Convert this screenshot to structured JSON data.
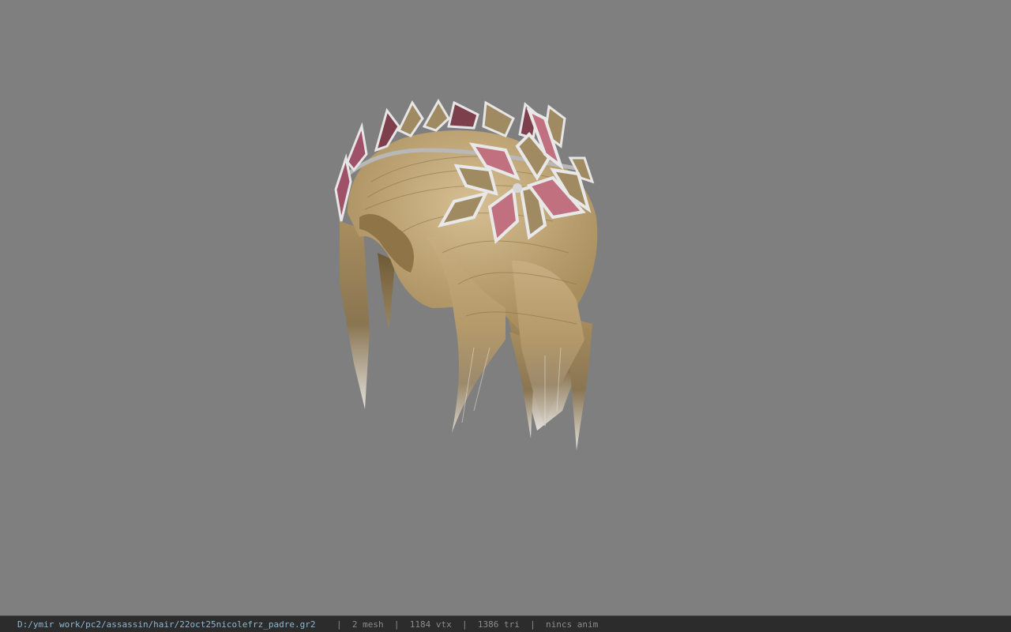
{
  "viewport": {
    "background": "#7f7f7f",
    "model_name": "hair-with-leaf-crown-model"
  },
  "statusbar": {
    "path": "D:/ymir work/pc2/assassin/hair/22oct25nicolefrz_padre.gr2",
    "separator": "|",
    "mesh": "2 mesh",
    "vtx": "1184 vtx",
    "tri": "1386 tri",
    "anim": "nincs anim",
    "path_color": "#8fb7cf",
    "text_color": "#8c8c8c"
  }
}
